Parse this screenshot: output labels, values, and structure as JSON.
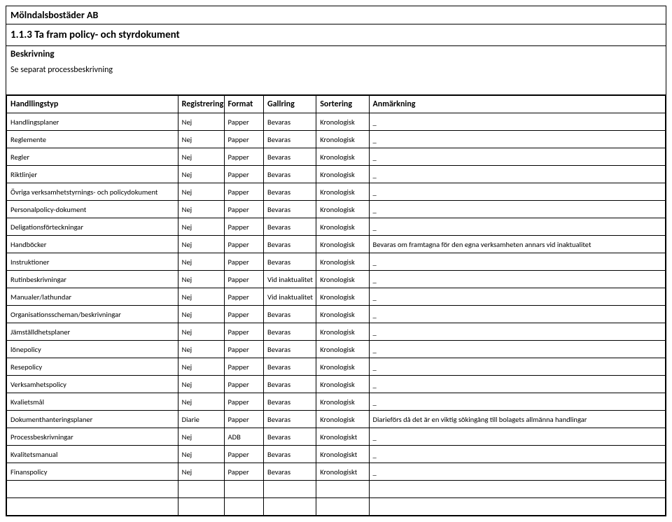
{
  "header": {
    "company": "Mölndalsbostäder AB",
    "section": "1.1.3 Ta fram policy- och styrdokument",
    "desc_label": "Beskrivning",
    "desc_text": "Se separat processbeskrivning"
  },
  "columns": [
    "Handllingstyp",
    "Registrering",
    "Format",
    "Gallring",
    "Sortering",
    "Anmärkning"
  ],
  "rows": [
    {
      "c": [
        "Handlingsplaner",
        "Nej",
        "Papper",
        "Bevaras",
        "Kronologisk",
        "_"
      ]
    },
    {
      "c": [
        "Reglemente",
        "Nej",
        "Papper",
        "Bevaras",
        "Kronologisk",
        "_"
      ]
    },
    {
      "c": [
        "Regler",
        "Nej",
        "Papper",
        "Bevaras",
        "Kronologisk",
        "_"
      ]
    },
    {
      "c": [
        "Riktlinjer",
        "Nej",
        "Papper",
        "Bevaras",
        "Kronologisk",
        "_"
      ]
    },
    {
      "c": [
        "Övriga verksamhetstyrnings- och policydokument",
        "Nej",
        "Papper",
        "Bevaras",
        "Kronologisk",
        "_"
      ]
    },
    {
      "c": [
        "Personalpolicy-dokument",
        "Nej",
        "Papper",
        "Bevaras",
        "Kronologisk",
        "_"
      ]
    },
    {
      "c": [
        "Deligationsförteckningar",
        "Nej",
        "Papper",
        "Bevaras",
        "Kronologisk",
        "_"
      ]
    },
    {
      "c": [
        "Handböcker",
        "Nej",
        "Papper",
        "Bevaras",
        "Kronologisk",
        "Bevaras om framtagna för den egna verksamheten annars vid inaktualitet"
      ]
    },
    {
      "c": [
        "Instruktioner",
        "Nej",
        "Papper",
        "Bevaras",
        "Kronologisk",
        "_"
      ]
    },
    {
      "c": [
        "Rutinbeskrivningar",
        "Nej",
        "Papper",
        "Vid inaktualitet",
        "Kronologisk",
        "_"
      ]
    },
    {
      "c": [
        "Manualer/lathundar",
        "Nej",
        "Papper",
        "Vid inaktualitet",
        "Kronologisk",
        "_"
      ]
    },
    {
      "c": [
        "Organisationsscheman/beskrivningar",
        "Nej",
        "Papper",
        "Bevaras",
        "Kronologisk",
        "_"
      ]
    },
    {
      "c": [
        "Jämställdhetsplaner",
        "Nej",
        "Papper",
        "Bevaras",
        "Kronologisk",
        "_"
      ]
    },
    {
      "c": [
        "lönepolicy",
        "Nej",
        "Papper",
        "Bevaras",
        "Kronologisk",
        "_"
      ]
    },
    {
      "c": [
        "Resepolicy",
        "Nej",
        "Papper",
        "Bevaras",
        "Kronologisk",
        "_"
      ]
    },
    {
      "c": [
        "Verksamhetspolicy",
        "Nej",
        "Papper",
        "Bevaras",
        "Kronologisk",
        "_"
      ]
    },
    {
      "c": [
        "Kvalietsmål",
        "Nej",
        "Papper",
        "Bevaras",
        "Kronologisk",
        "_"
      ]
    },
    {
      "c": [
        "Dokumenthanteringsplaner",
        "Diarie",
        "Papper",
        "Bevaras",
        "Kronologisk",
        "Diarieförs då det är en viktig sökingång till bolagets allmänna handlingar"
      ]
    },
    {
      "c": [
        "Processbeskrivningar",
        "Nej",
        "ADB",
        "Bevaras",
        "Kronologiskt",
        "_"
      ]
    },
    {
      "c": [
        "Kvalitetsmanual",
        "Nej",
        "Papper",
        "Bevaras",
        "Kronologiskt",
        "_"
      ]
    },
    {
      "c": [
        "Finanspolicy",
        "Nej",
        "Papper",
        "Bevaras",
        "Kronologiskt",
        "_"
      ]
    }
  ],
  "trailing_empty_rows": 2
}
